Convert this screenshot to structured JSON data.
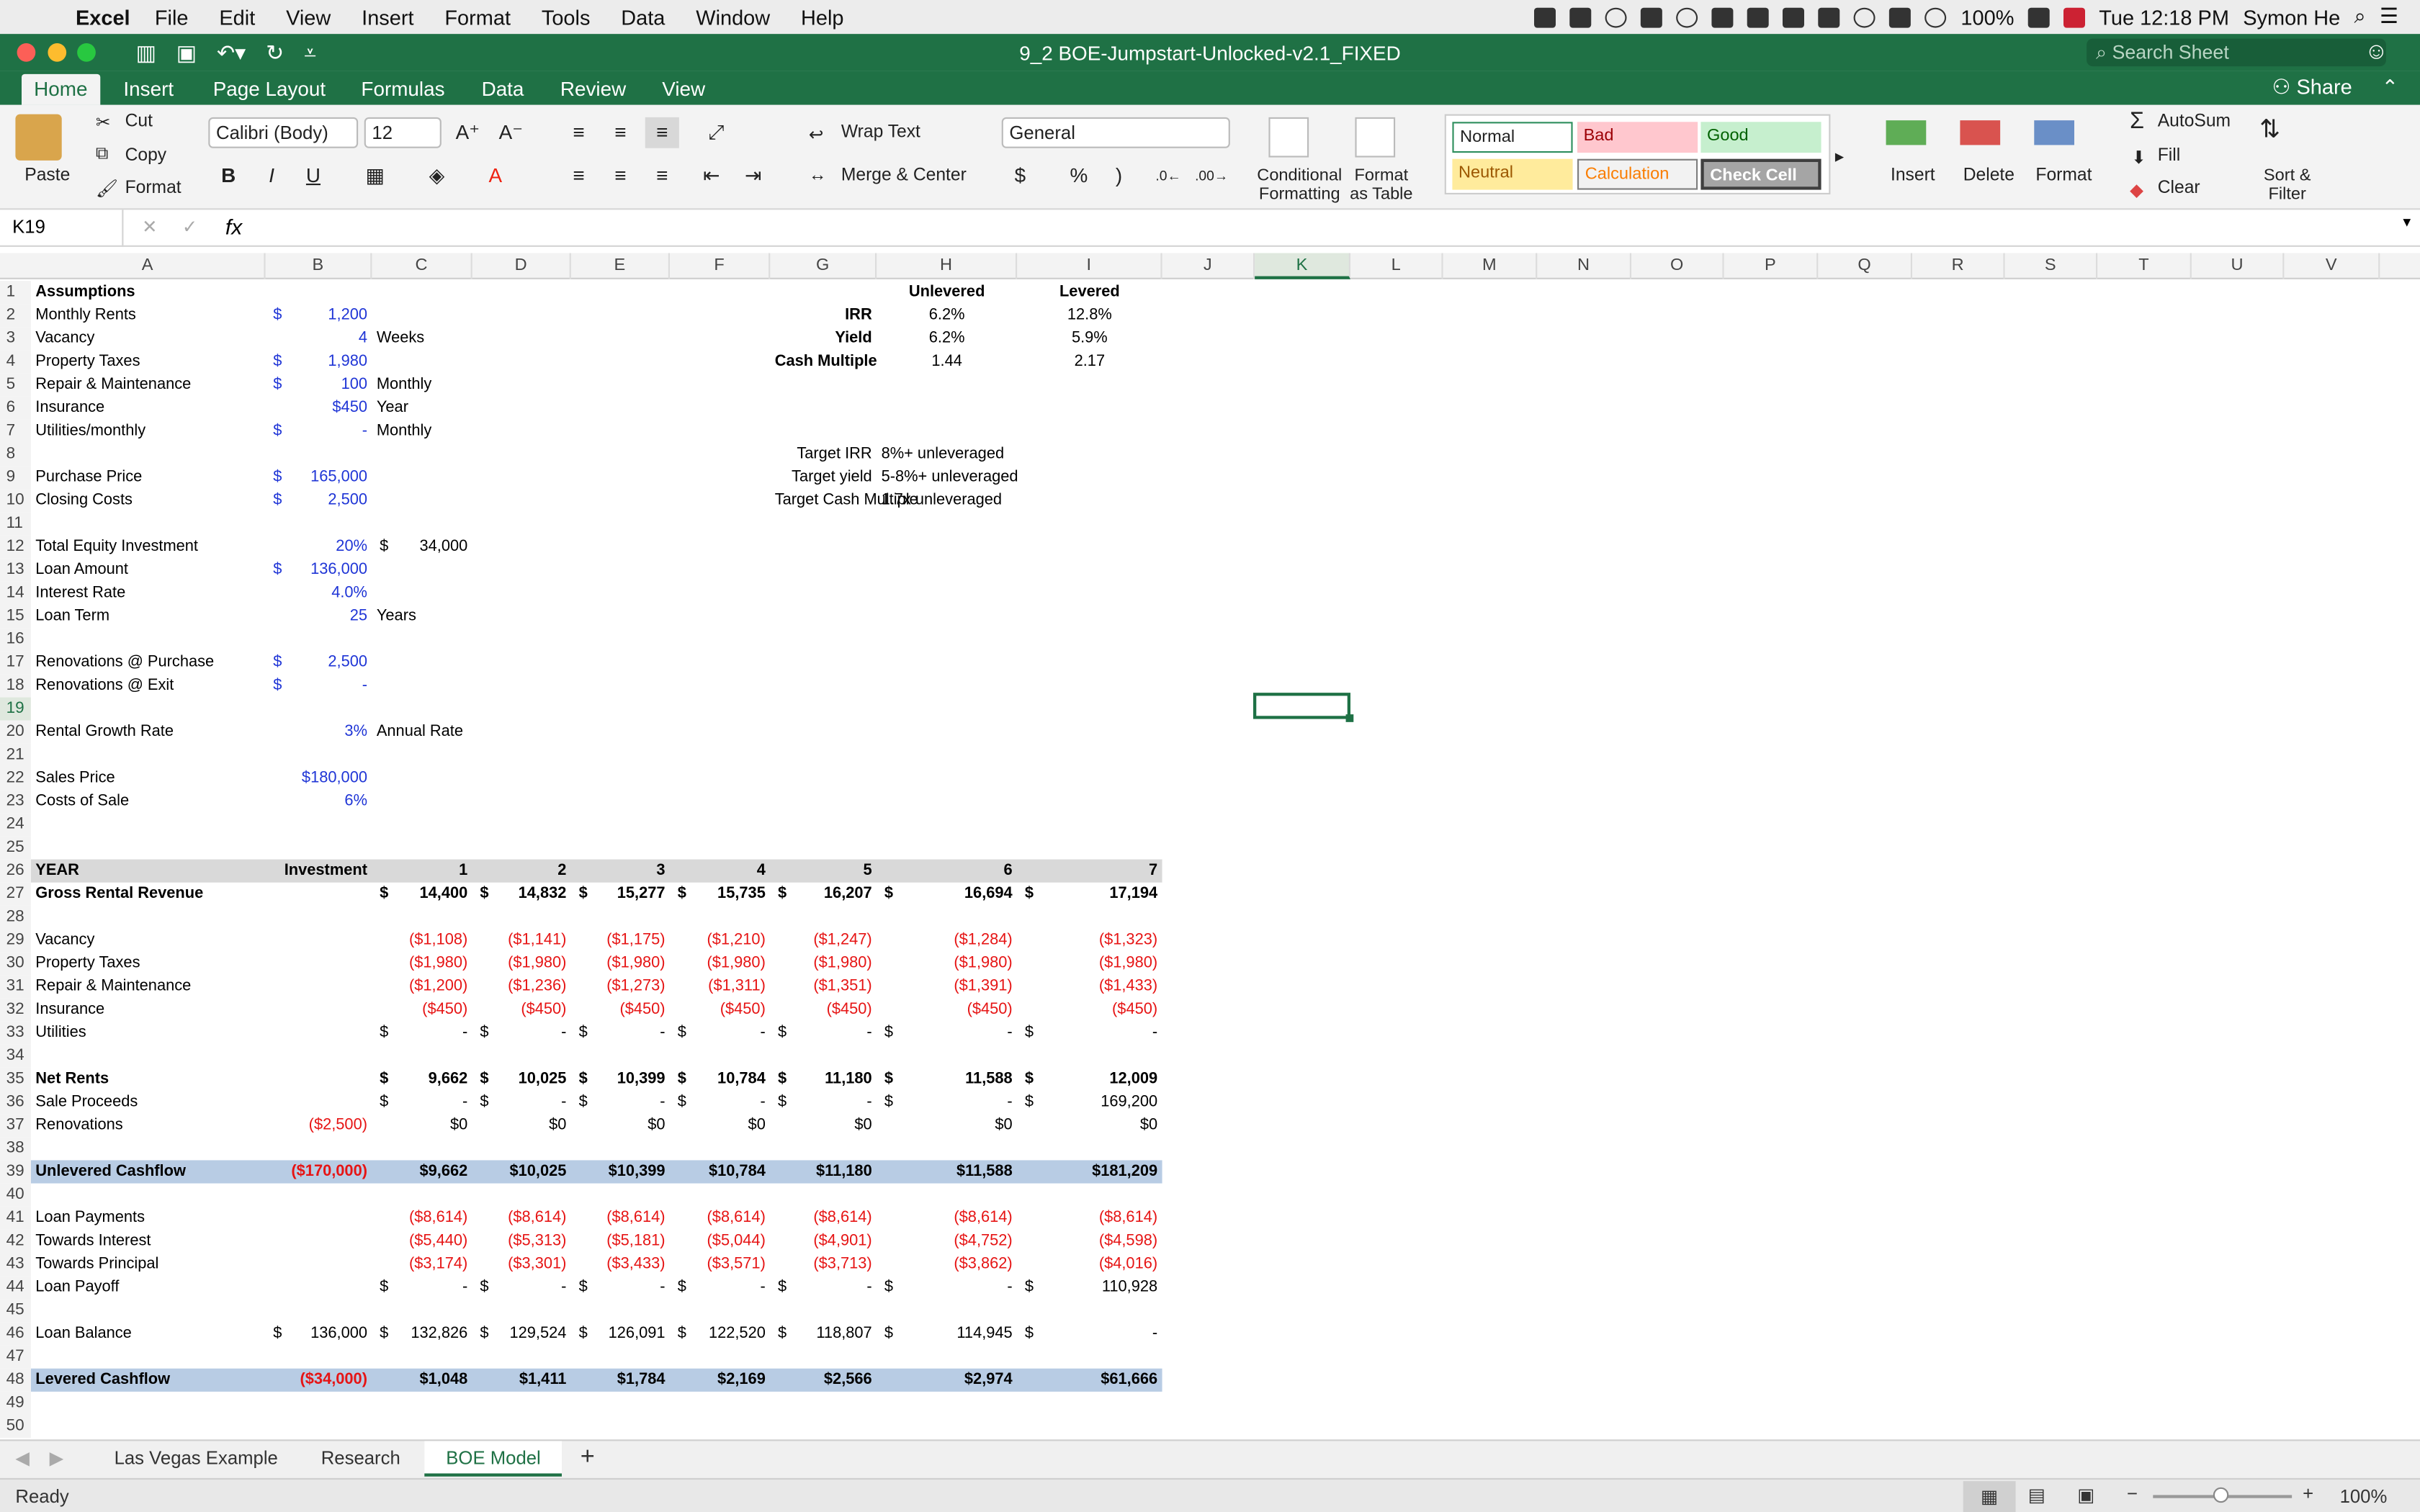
{
  "menubar": {
    "app": "Excel",
    "items": [
      "File",
      "Edit",
      "View",
      "Insert",
      "Format",
      "Tools",
      "Data",
      "Window",
      "Help"
    ],
    "battery": "100%",
    "clock": "Tue 12:18 PM",
    "user": "Symon He"
  },
  "window": {
    "title": "9_2 BOE-Jumpstart-Unlocked-v2.1_FIXED",
    "search_placeholder": "Search Sheet",
    "share": "Share"
  },
  "tabs": [
    "Home",
    "Insert",
    "Page Layout",
    "Formulas",
    "Data",
    "Review",
    "View"
  ],
  "ribbon": {
    "paste": "Paste",
    "cut": "Cut",
    "copy": "Copy",
    "format_painter": "Format",
    "font": "Calibri (Body)",
    "size": "12",
    "bold": "B",
    "italic": "I",
    "underline": "U",
    "wrap_text": "Wrap Text",
    "merge_center": "Merge & Center",
    "number_format": "General",
    "currency": "$",
    "percent": "%",
    "comma": ")",
    "cond_format": "Conditional Formatting",
    "format_table": "Format as Table",
    "styles": [
      "Normal",
      "Bad",
      "Good",
      "Neutral",
      "Calculation",
      "Check Cell"
    ],
    "insert": "Insert",
    "delete": "Delete",
    "format": "Format",
    "autosum": "AutoSum",
    "fill": "Fill",
    "clear": "Clear",
    "sort_filter": "Sort & Filter"
  },
  "formula_bar": {
    "name_box": "K19",
    "fx": "fx",
    "content": ""
  },
  "columns": [
    "A",
    "B",
    "C",
    "D",
    "E",
    "F",
    "G",
    "H",
    "I",
    "J",
    "K",
    "L",
    "M",
    "N",
    "O",
    "P",
    "Q",
    "R",
    "S",
    "T",
    "U",
    "V"
  ],
  "rows": [
    [
      "Assumptions",
      "",
      "",
      "",
      "",
      "",
      "",
      "Unlevered",
      "Levered"
    ],
    [
      "Monthly Rents",
      "$ 1,200",
      "",
      "",
      "",
      "",
      "IRR",
      "6.2%",
      "12.8%"
    ],
    [
      "Vacancy",
      "4",
      "Weeks",
      "",
      "",
      "",
      "Yield",
      "6.2%",
      "5.9%"
    ],
    [
      "Property Taxes",
      "$ 1,980",
      "",
      "",
      "",
      "",
      "Cash Multiple",
      "1.44",
      "2.17"
    ],
    [
      "Repair & Maintenance",
      "$ 100",
      "Monthly"
    ],
    [
      "Insurance",
      "$450",
      "Year"
    ],
    [
      "Utilities/monthly",
      "$ -",
      "Monthly"
    ],
    [
      "",
      "",
      "",
      "",
      "",
      "",
      "Target IRR",
      "8%+ unleveraged"
    ],
    [
      "Purchase Price",
      "$ 165,000",
      "",
      "",
      "",
      "",
      "Target yield",
      "5-8%+ unleveraged"
    ],
    [
      "Closing Costs",
      "$ 2,500",
      "",
      "",
      "",
      "",
      "Target Cash Multiple",
      "1.7x unleveraged"
    ],
    [],
    [
      "Total Equity Investment",
      "20%",
      "$ 34,000"
    ],
    [
      "Loan Amount",
      "$ 136,000"
    ],
    [
      "Interest Rate",
      "4.0%"
    ],
    [
      "Loan Term",
      "25",
      "Years"
    ],
    [],
    [
      "Renovations @ Purchase",
      "$ 2,500"
    ],
    [
      "Renovations @ Exit",
      "$ -"
    ],
    [],
    [
      "Rental Growth Rate",
      "3%",
      "Annual Rate"
    ],
    [],
    [
      "Sales Price",
      "$180,000"
    ],
    [
      "Costs of Sale",
      "6%"
    ],
    [],
    [],
    [
      "YEAR",
      "Investment",
      "1",
      "2",
      "3",
      "4",
      "5",
      "6",
      "7"
    ],
    [
      "Gross Rental Revenue",
      "",
      "$ 14,400",
      "$ 14,832",
      "$ 15,277",
      "$ 15,735",
      "$ 16,207",
      "$ 16,694",
      "$ 17,194"
    ],
    [],
    [
      "Vacancy",
      "",
      "($1,108)",
      "($1,141)",
      "($1,175)",
      "($1,210)",
      "($1,247)",
      "($1,284)",
      "($1,323)"
    ],
    [
      "Property Taxes",
      "",
      "($1,980)",
      "($1,980)",
      "($1,980)",
      "($1,980)",
      "($1,980)",
      "($1,980)",
      "($1,980)"
    ],
    [
      "Repair & Maintenance",
      "",
      "($1,200)",
      "($1,236)",
      "($1,273)",
      "($1,311)",
      "($1,351)",
      "($1,391)",
      "($1,433)"
    ],
    [
      "Insurance",
      "",
      "($450)",
      "($450)",
      "($450)",
      "($450)",
      "($450)",
      "($450)",
      "($450)"
    ],
    [
      "Utilities",
      "",
      "$ -",
      "$ -",
      "$ -",
      "$ -",
      "$ -",
      "$ -",
      "$ -"
    ],
    [],
    [
      "Net Rents",
      "",
      "$ 9,662",
      "$ 10,025",
      "$ 10,399",
      "$ 10,784",
      "$ 11,180",
      "$ 11,588",
      "$ 12,009"
    ],
    [
      "Sale Proceeds",
      "",
      "$ -",
      "$ -",
      "$ -",
      "$ -",
      "$ -",
      "$ -",
      "$ 169,200"
    ],
    [
      "Renovations",
      "($2,500)",
      "$0",
      "$0",
      "$0",
      "$0",
      "$0",
      "$0",
      "$0"
    ],
    [],
    [
      "Unlevered Cashflow",
      "($170,000)",
      "$9,662",
      "$10,025",
      "$10,399",
      "$10,784",
      "$11,180",
      "$11,588",
      "$181,209"
    ],
    [],
    [
      "Loan Payments",
      "",
      "($8,614)",
      "($8,614)",
      "($8,614)",
      "($8,614)",
      "($8,614)",
      "($8,614)",
      "($8,614)"
    ],
    [
      "Towards Interest",
      "",
      "($5,440)",
      "($5,313)",
      "($5,181)",
      "($5,044)",
      "($4,901)",
      "($4,752)",
      "($4,598)"
    ],
    [
      "Towards Principal",
      "",
      "($3,174)",
      "($3,301)",
      "($3,433)",
      "($3,571)",
      "($3,713)",
      "($3,862)",
      "($4,016)"
    ],
    [
      "Loan Payoff",
      "",
      "$ -",
      "$ -",
      "$ -",
      "$ -",
      "$ -",
      "$ -",
      "$ 110,928"
    ],
    [],
    [
      "Loan Balance",
      "$ 136,000",
      "$ 132,826",
      "$ 129,524",
      "$ 126,091",
      "$ 122,520",
      "$ 118,807",
      "$ 114,945",
      "$ -"
    ],
    [],
    [
      "Levered Cashflow",
      "($34,000)",
      "$1,048",
      "$1,411",
      "$1,784",
      "$2,169",
      "$2,566",
      "$2,974",
      "$61,666"
    ],
    [],
    []
  ],
  "sheets": [
    "Las Vegas Example",
    "Research",
    "BOE Model"
  ],
  "status": {
    "ready": "Ready",
    "zoom": "100%"
  },
  "colors": {
    "excel_green": "#1f7145",
    "input_blue": "#1f35d6",
    "negative_red": "#e61414",
    "band_blue": "#b8cce4",
    "band_gray": "#d9d9d9"
  }
}
